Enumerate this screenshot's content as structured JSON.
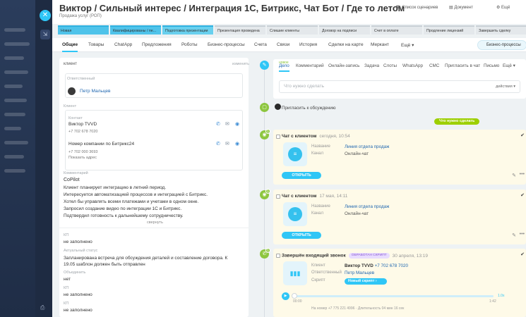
{
  "header": {
    "title": "Виктор / Сильный интерес / Интеграция 1С, Битрикс, Чат Бот / Где то летом",
    "subtitle": "Продажа услуг (РОП)",
    "right_items": [
      "Список сценариев",
      "Документ",
      "Ещё"
    ]
  },
  "stages": [
    "Новая",
    "Квалифицированы / пе...",
    "Подготовка презентации",
    "Презентация проведена",
    "Слишие клиенты",
    "Договор на подписи",
    "Счет в оплате",
    "Продление лицензий",
    "Завершить сделку"
  ],
  "tabs": [
    "Общие",
    "Товары",
    "ChatApp",
    "Предложения",
    "Роботы",
    "Бизнес-процессы",
    "Счета",
    "Связи",
    "История",
    "Сделки на карте",
    "Меркант",
    "Ещё"
  ],
  "bp_button": "Бизнес-процессы",
  "left": {
    "section_title": "клиент",
    "change_link": "изменить",
    "responsible_label": "Ответственный",
    "responsible_name": "Петр Мальцев",
    "client_label": "Клиент",
    "contact_label": "Контакт",
    "contact_name": "Виктор TVVD",
    "contact_phone": "+7 702 678 7020",
    "company_name": "Номер компании по Битрикс24",
    "company_phone": "+7 702 000 3693",
    "show_address": "Показать адрес",
    "comment_label": "Комментарий",
    "comment_lines": [
      "CoPilot",
      "Клиент планирует интеграцию в летний период.",
      "Интересуется автоматизацией процессов и интеграцией с Битрикс.",
      "Хотел бы управлять всеми платежами и учетами в одном окне.",
      "Запросил создание видео по интеграции 1С и Битрикс.",
      "Подтвердил готовность к дальнейшему сотрудничеству."
    ],
    "collapse": "свернуть",
    "kp_label": "КП",
    "kp_value": "не заполнено",
    "status_label": "Актуальный статус",
    "status_value": "Запланирована встреча для обсуждения деталей и составление договора. К 19.05 шаблон должен быть отправлен",
    "merge_label": "Объединить",
    "merge_value": "нет",
    "kp2_label": "КП",
    "kp2_value": "не заполнено",
    "kp3_label": "КП",
    "kp3_value": "не заполнено"
  },
  "editor": {
    "hint": "новое",
    "tabs": [
      "Дело",
      "Комментарий",
      "Онлайн-запись",
      "Задача",
      "Слоты",
      "WhatsApp",
      "СМС",
      "Пригласить в чат",
      "Письмо",
      "Ещё"
    ],
    "placeholder": "Что нужно сделать",
    "action": "действия"
  },
  "invite_text": "Пригласить к обсуждению",
  "todo_pill": "Что нужно сделать",
  "activities": [
    {
      "title": "Чат с клиентом",
      "date": "сегодня, 10:54",
      "k1": "Название",
      "v1": "Линия отдела продаж",
      "k2": "Канал",
      "v2": "Онлайн-чат",
      "button": "ОТКРЫТЬ"
    },
    {
      "title": "Чат с клиентом",
      "date": "17 мая, 14:11",
      "k1": "Название",
      "v1": "Линия отдела продаж",
      "k2": "Канал",
      "v2": "Онлайн-чат",
      "button": "ОТКРЫТЬ"
    }
  ],
  "call": {
    "title": "Завершён входящий звонок",
    "tag": "ОБРАБОТАН СКРИПТ",
    "date": "30 апреля, 13:19",
    "k1": "Клиент",
    "v1": "Виктор TVVD",
    "v1b": "+7 702 678 7020",
    "k2": "Ответственный",
    "v2": "Петр Мальцев",
    "k3": "Скрипт",
    "script_btn": "Новый скрипт",
    "speed": "1.0x",
    "t_start": "00:00",
    "t_end": "1:42",
    "footer": "На номер +7 775 221 4996 · Длительность 04 мин 16 сек"
  }
}
